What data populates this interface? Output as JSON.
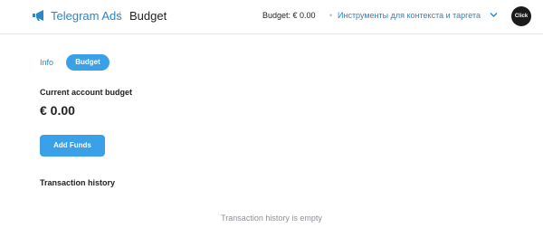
{
  "header": {
    "brand": "Telegram Ads",
    "separator": "/",
    "current_page": "Budget",
    "budget_label": "Budget: € 0.00",
    "dot": "•",
    "account_name": "Инструменты для контекста и таргета",
    "avatar_text": "Click",
    "colors": {
      "brand": "#2c86c7",
      "avatar_bg": "#1b1b1b"
    }
  },
  "tabs": [
    {
      "label": "Info",
      "active": false
    },
    {
      "label": "Budget",
      "active": true
    }
  ],
  "budget": {
    "title": "Current account budget",
    "amount": "€ 0.00",
    "add_funds_label": "Add Funds",
    "accent": "#3aa0e8"
  },
  "transactions": {
    "title": "Transaction history",
    "empty_message": "Transaction history is empty"
  }
}
